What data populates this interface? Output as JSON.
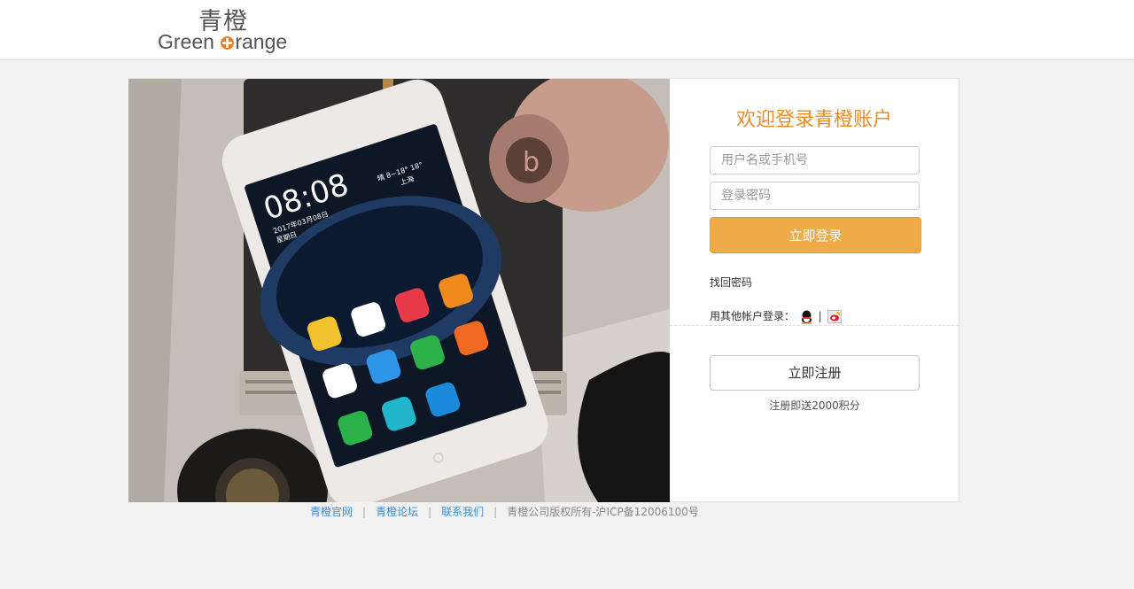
{
  "logo": {
    "cn": "青橙",
    "en_before": "Green ",
    "en_after": "range",
    "brand_color": "#ef7d26"
  },
  "login": {
    "title": "欢迎登录青橙账户",
    "username_placeholder": "用户名或手机号",
    "password_placeholder": "登录密码",
    "submit_label": "立即登录",
    "forgot_label": "找回密码",
    "other_accounts_label": "用其他帐户登录：",
    "separator": "|",
    "icons": [
      "qq-icon",
      "weibo-icon"
    ]
  },
  "register": {
    "button_label": "立即注册",
    "note": "注册即送2000积分"
  },
  "hero": {
    "phone_time": "08:08",
    "phone_date": "2017年03月08日",
    "phone_weekday": "星期日",
    "weather_temp": "晴 8~18° 18°",
    "weather_city": "上海"
  },
  "footer": {
    "links": [
      "青橙官网",
      "青橙论坛",
      "联系我们"
    ],
    "separator": "|",
    "copyright": "青橙公司版权所有-沪ICP备12006100号"
  },
  "colors": {
    "accent": "#ef8b23",
    "button": "#eeab47",
    "link": "#3b8ed6",
    "page_bg": "#f1f1f1"
  }
}
